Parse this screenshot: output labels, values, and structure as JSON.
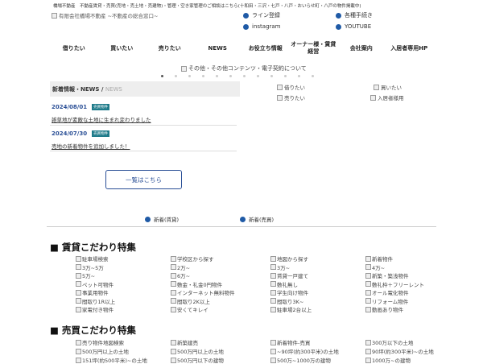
{
  "header": {
    "topline": "橋場不動産　不動産賃貸・売買(売地・売土地・売建物)・管理・空き家管理のご相談はこちら(十和田・三沢・七戸・八戸・おいらせ町・八戸の物件掲載中)",
    "logo_alt": "有限会社橋場不動産 ~不動産の総合窓口~",
    "links": [
      {
        "label": "ライン登録",
        "icon": "line-icon"
      },
      {
        "label": "各種手続き",
        "icon": "procedure-icon"
      },
      {
        "label": "instagram",
        "icon": "instagram-icon"
      },
      {
        "label": "YOUTUBE",
        "icon": "youtube-icon"
      }
    ]
  },
  "nav": [
    {
      "label": "借りたい"
    },
    {
      "label": "買いたい"
    },
    {
      "label": "売りたい"
    },
    {
      "label": "NEWS"
    },
    {
      "label": "お役立ち情報"
    },
    {
      "label": "オーナー様・賃貸\n経営"
    },
    {
      "label": "会社案内"
    },
    {
      "label": "入居者専用HP"
    }
  ],
  "slider": {
    "caption": "その他・その他コンテンツ・電子契約について",
    "count": 12,
    "active": 0
  },
  "news": {
    "heading": "新着情報・NEWS / ",
    "heading_sub": "NEWS",
    "items": [
      {
        "date": "2024/08/01",
        "badge": "売買物件",
        "title": "雑草地が素敵な土地に生まれ変わりました"
      },
      {
        "date": "2024/07/30",
        "badge": "売買物件",
        "title": "売地の新着物件を追加しました！"
      }
    ],
    "button": "一覧はこちら"
  },
  "right_links": [
    {
      "label": "借りたい"
    },
    {
      "label": "買いたい"
    },
    {
      "label": "売りたい"
    },
    {
      "label": "入居者様用"
    }
  ],
  "tabs": [
    {
      "label": "新着(賃貸)"
    },
    {
      "label": "新着(売買)"
    }
  ],
  "rental": {
    "title": "■ 賃貸こだわり特集",
    "items": [
      "駐車場検索",
      "学校区から探す",
      "地図から探す",
      "新着物件",
      "3万~5万",
      "2万~",
      "3万~",
      "4万~",
      "5万~",
      "6万~",
      "賃貸一戸建て",
      "新築・築浅物件",
      "ペット可物件",
      "敷金・礼金0円物件",
      "敷礼無し",
      "敷礼枠＋フリーレント",
      "事業用物件",
      "インターネット無料物件",
      "学生向け物件",
      "オール電化物件",
      "間取り1R以上",
      "間取り2K以上",
      "間取り3K~",
      "リフォーム物件",
      "家電付き物件",
      "安くてキレイ",
      "駐車場2台以上",
      "動画あり物件"
    ]
  },
  "sale": {
    "title": "■ 売買こだわり特集",
    "items": [
      "売り物件地図検索",
      "新築建売",
      "新着物件-売買",
      "300万以下の土地",
      "500万円以上の土地",
      "500万円以上の土地",
      "~90坪(約300平米)の土地",
      "90坪(約300平米)~の土地",
      "151坪(約500平米)~の土地",
      "500万円以下の建物",
      "500万~1000万の建物",
      "1000万~の建物"
    ]
  }
}
